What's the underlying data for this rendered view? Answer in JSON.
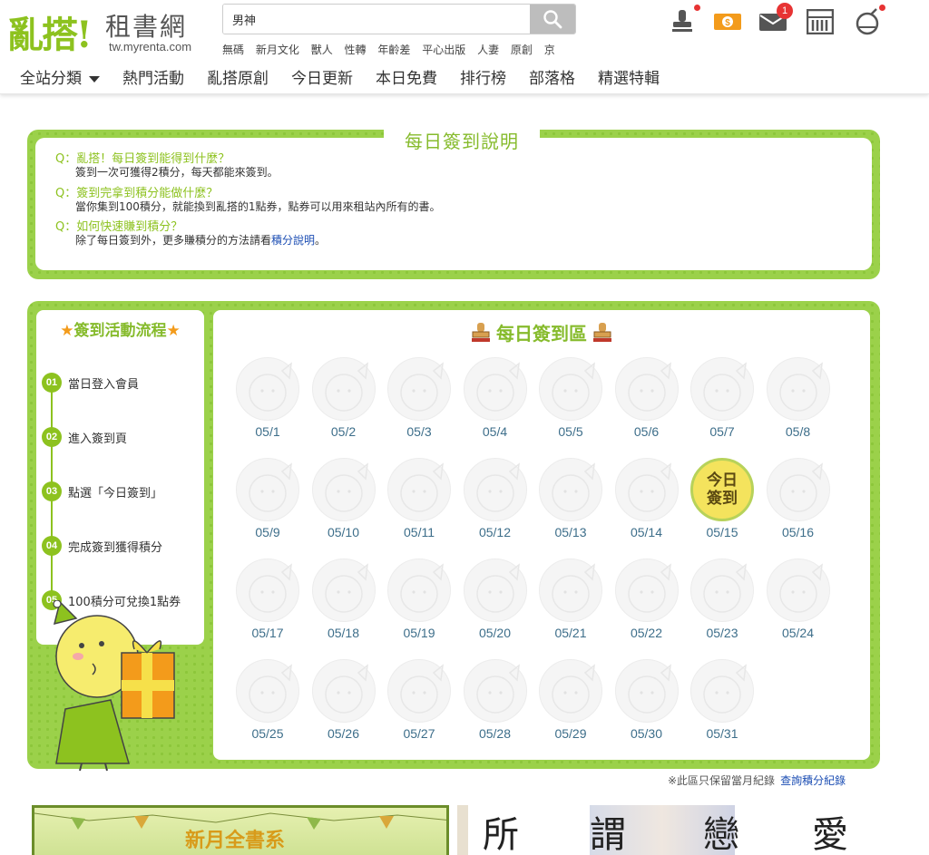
{
  "header": {
    "logo_main": "亂搭!",
    "logo_sub": "租書網",
    "logo_url": "tw.myrenta.com",
    "search_value": "男神",
    "hot_tags": [
      "無碼",
      "新月文化",
      "獸人",
      "性轉",
      "年齡差",
      "平心出版",
      "人妻",
      "原創",
      "京"
    ],
    "mail_count": "1"
  },
  "nav": {
    "items": [
      "全站分類",
      "熱門活動",
      "亂搭原創",
      "今日更新",
      "本日免費",
      "排行榜",
      "部落格",
      "精選特輯"
    ]
  },
  "faq": {
    "title": "每日簽到說明",
    "items": [
      {
        "q": "Q：亂搭！每日簽到能得到什麼？",
        "a": "簽到一次可獲得2積分，每天都能來簽到。"
      },
      {
        "q": "Q：簽到完拿到積分能做什麼？",
        "a": "當你集到100積分，就能換到亂搭的1點券，點券可以用來租站內所有的書。"
      },
      {
        "q": "Q：如何快速賺到積分？",
        "a": "除了每日簽到外，更多賺積分的方法請看",
        "link": "積分說明",
        "tail": "。"
      }
    ]
  },
  "flow": {
    "title": "簽到活動流程",
    "steps": [
      {
        "num": "01",
        "label": "當日登入會員"
      },
      {
        "num": "02",
        "label": "進入簽到頁"
      },
      {
        "num": "03",
        "label": "點選「今日簽到」"
      },
      {
        "num": "04",
        "label": "完成簽到獲得積分"
      },
      {
        "num": "05",
        "label": "100積分可兌換1點券"
      }
    ]
  },
  "checkin": {
    "title": "每日簽到區",
    "today_line1": "今日",
    "today_line2": "簽到",
    "days": [
      "05/1",
      "05/2",
      "05/3",
      "05/4",
      "05/5",
      "05/6",
      "05/7",
      "05/8",
      "05/9",
      "05/10",
      "05/11",
      "05/12",
      "05/13",
      "05/14",
      "05/15",
      "05/16",
      "05/17",
      "05/18",
      "05/19",
      "05/20",
      "05/21",
      "05/22",
      "05/23",
      "05/24",
      "05/25",
      "05/26",
      "05/27",
      "05/28",
      "05/29",
      "05/30",
      "05/31"
    ],
    "today_index": 14
  },
  "note": {
    "text": "※此區只保留當月紀錄",
    "link": "查詢積分紀錄"
  },
  "banners": {
    "banner1_text": "新月全書系",
    "banner2_chars": [
      "所",
      "謂",
      "戀",
      "愛"
    ]
  },
  "colors": {
    "brand_green": "#8dc21f",
    "alert_red": "#e73333",
    "coin_orange": "#f39b1b"
  }
}
